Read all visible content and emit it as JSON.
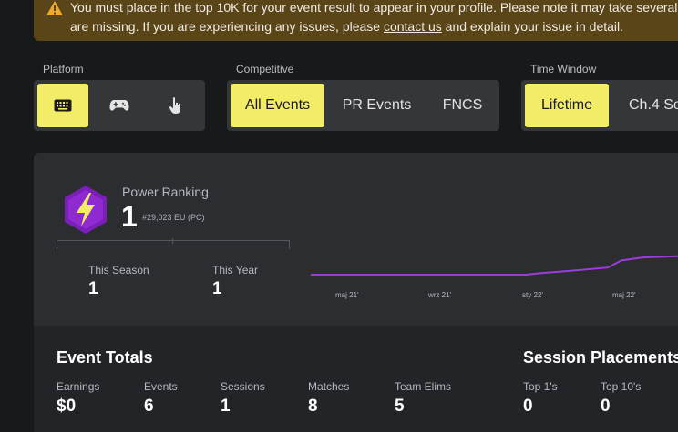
{
  "notice": {
    "line1": "You must place in the top 10K for your event result to appear in your profile. Please note it may take several h",
    "line2_pre": "are missing. If you are experiencing any issues, please ",
    "link": "contact us",
    "line2_post": " and explain your issue in detail."
  },
  "filters": {
    "platform": {
      "label": "Platform",
      "options": [
        "keyboard-icon",
        "gamepad-icon",
        "touch-icon"
      ],
      "selected": "keyboard-icon"
    },
    "competitive": {
      "label": "Competitive",
      "options": [
        "All Events",
        "PR Events",
        "FNCS"
      ],
      "selected": "All Events"
    },
    "time_window": {
      "label": "Time Window",
      "options": [
        "Lifetime",
        "Ch.4 Se"
      ],
      "selected": "Lifetime"
    }
  },
  "power_ranking": {
    "label": "Power Ranking",
    "value": "1",
    "sub": "#29,023 EU (PC)",
    "this_season_label": "This Season",
    "this_season_value": "1",
    "this_year_label": "This Year",
    "this_year_value": "1",
    "line_color": "#9d3cd8"
  },
  "chart_data": {
    "type": "line",
    "x": [
      "maj 21'",
      "wrz 21'",
      "sty 22'",
      "maj 22'"
    ],
    "series": [
      {
        "values": [
          1,
          1,
          1,
          1.15,
          1.3,
          1.6,
          2.2,
          2.45,
          2.6
        ]
      }
    ]
  },
  "event_totals": {
    "title": "Event Totals",
    "items": [
      {
        "label": "Earnings",
        "value": "$0"
      },
      {
        "label": "Events",
        "value": "6"
      },
      {
        "label": "Sessions",
        "value": "1"
      },
      {
        "label": "Matches",
        "value": "8"
      },
      {
        "label": "Team Elims",
        "value": "5"
      }
    ]
  },
  "session_placements": {
    "title": "Session Placements",
    "items": [
      {
        "label": "Top 1's",
        "value": "0"
      },
      {
        "label": "Top 10's",
        "value": "0"
      }
    ]
  }
}
